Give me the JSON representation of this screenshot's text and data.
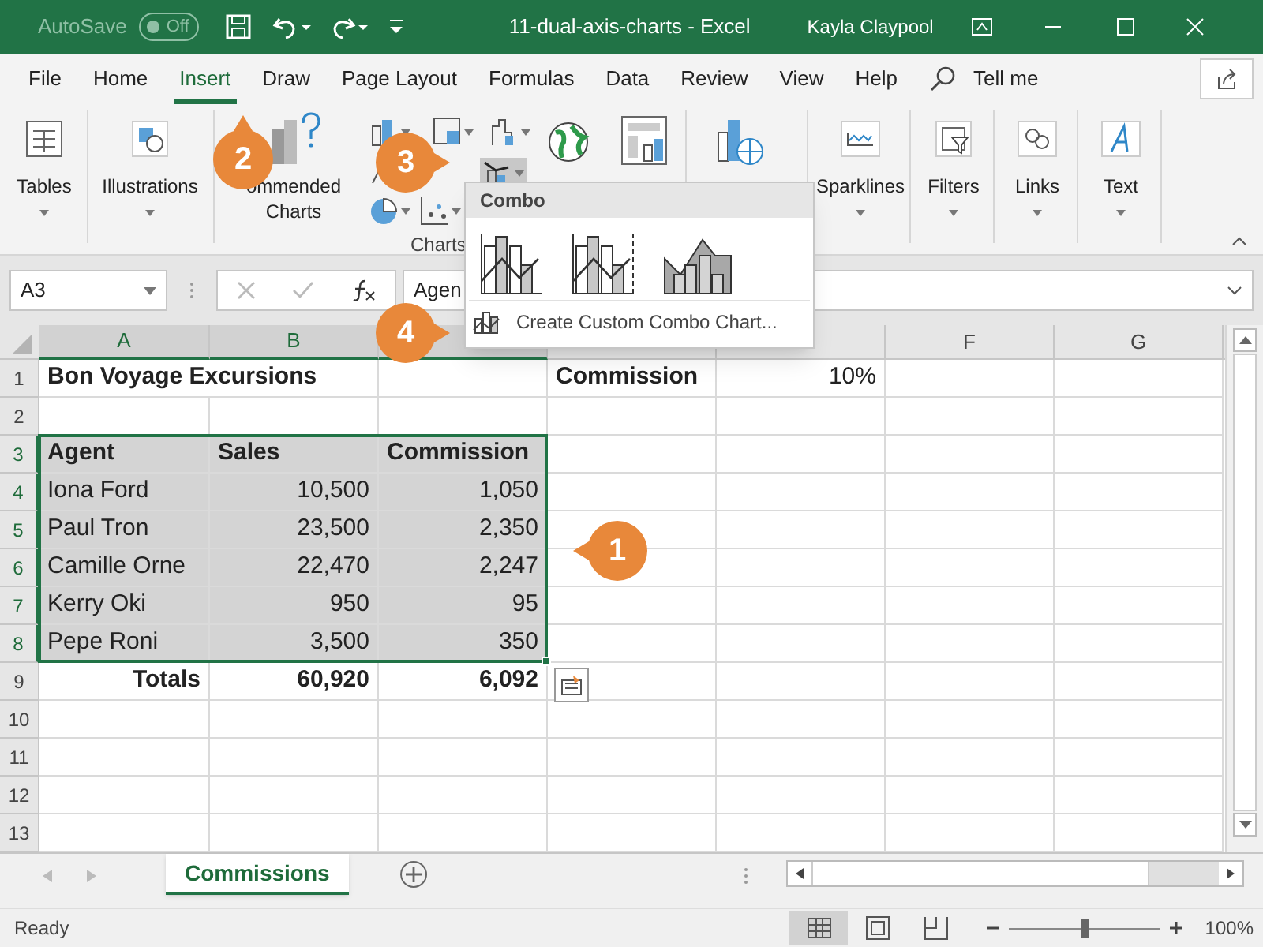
{
  "title_bar": {
    "autosave_label": "AutoSave",
    "autosave_toggle": {
      "label": "Off",
      "on": false
    },
    "title": "11-dual-axis-charts  -  Excel",
    "user": "Kayla Claypool"
  },
  "tabs": [
    {
      "label": "File",
      "selected": false
    },
    {
      "label": "Home",
      "selected": false
    },
    {
      "label": "Insert",
      "selected": true
    },
    {
      "label": "Draw",
      "selected": false
    },
    {
      "label": "Page Layout",
      "selected": false
    },
    {
      "label": "Formulas",
      "selected": false
    },
    {
      "label": "Data",
      "selected": false
    },
    {
      "label": "Review",
      "selected": false
    },
    {
      "label": "View",
      "selected": false
    },
    {
      "label": "Help",
      "selected": false
    }
  ],
  "tell_me": "Tell me",
  "ribbon": {
    "items": [
      {
        "kind": "tables",
        "label": "Tables"
      },
      {
        "kind": "illustrations",
        "label": "Illustrations"
      },
      {
        "kind": "recommended",
        "label": "ommended Charts"
      },
      {
        "kind": "chart-grid"
      },
      {
        "kind": "maps"
      },
      {
        "kind": "pivotchart"
      },
      {
        "kind": "geo"
      },
      {
        "kind": "sparklines",
        "label": "Sparklines"
      },
      {
        "kind": "filters",
        "label": "Filters"
      },
      {
        "kind": "links",
        "label": "Links"
      },
      {
        "kind": "text",
        "label": "Text"
      }
    ],
    "group_label": "Charts"
  },
  "combo_menu": {
    "header": "Combo",
    "options": [
      {
        "kind": "clustered"
      },
      {
        "kind": "secondary"
      },
      {
        "kind": "area"
      }
    ],
    "custom": "Create Custom Combo Chart..."
  },
  "formula_bar": {
    "name_box": "A3",
    "formula": "Agen"
  },
  "columns": [
    {
      "label": "A",
      "selected": true
    },
    {
      "label": "B",
      "selected": true
    },
    {
      "selected": true
    },
    {
      "selected": false
    },
    {
      "selected": false
    },
    {
      "label": "F",
      "selected": false
    },
    {
      "label": "G",
      "selected": false
    }
  ],
  "rows": [
    {
      "number": "1",
      "selected": false,
      "cells": [
        {
          "text": "Bon Voyage Excursions",
          "kind": "text",
          "bold": true,
          "selected": false
        },
        null,
        null,
        {
          "text": "Commission",
          "kind": "text",
          "bold": true,
          "selected": false
        },
        {
          "text": "10%",
          "kind": "number",
          "bold": false,
          "selected": false
        },
        null,
        null
      ]
    },
    {
      "number": "2",
      "selected": false,
      "cells": [
        null,
        null,
        null,
        null,
        null,
        null,
        null
      ]
    },
    {
      "number": "3",
      "selected": true,
      "cells": [
        {
          "text": "Agent",
          "kind": "text",
          "bold": true,
          "selected": true
        },
        {
          "text": "Sales",
          "kind": "text",
          "bold": true,
          "selected": true
        },
        {
          "text": "Commission",
          "kind": "text",
          "bold": true,
          "selected": true
        },
        null,
        null,
        null,
        null
      ]
    },
    {
      "number": "4",
      "selected": true,
      "cells": [
        {
          "text": "Iona Ford",
          "kind": "text",
          "bold": false,
          "selected": true
        },
        {
          "text": "10,500",
          "kind": "number",
          "bold": false,
          "selected": true
        },
        {
          "text": "1,050",
          "kind": "number",
          "bold": false,
          "selected": true
        },
        null,
        null,
        null,
        null
      ]
    },
    {
      "number": "5",
      "selected": true,
      "cells": [
        {
          "text": "Paul Tron",
          "kind": "text",
          "bold": false,
          "selected": true
        },
        {
          "text": "23,500",
          "kind": "number",
          "bold": false,
          "selected": true
        },
        {
          "text": "2,350",
          "kind": "number",
          "bold": false,
          "selected": true
        },
        null,
        null,
        null,
        null
      ]
    },
    {
      "number": "6",
      "selected": true,
      "cells": [
        {
          "text": "Camille  Orne",
          "kind": "text",
          "bold": false,
          "selected": true
        },
        {
          "text": "22,470",
          "kind": "number",
          "bold": false,
          "selected": true
        },
        {
          "text": "2,247",
          "kind": "number",
          "bold": false,
          "selected": true
        },
        null,
        null,
        null,
        null
      ]
    },
    {
      "number": "7",
      "selected": true,
      "cells": [
        {
          "text": "Kerry Oki",
          "kind": "text",
          "bold": false,
          "selected": true
        },
        {
          "text": "950",
          "kind": "number",
          "bold": false,
          "selected": true
        },
        {
          "text": "95",
          "kind": "number",
          "bold": false,
          "selected": true
        },
        null,
        null,
        null,
        null
      ]
    },
    {
      "number": "8",
      "selected": true,
      "cells": [
        {
          "text": "Pepe Roni",
          "kind": "text",
          "bold": false,
          "selected": true
        },
        {
          "text": "3,500",
          "kind": "number",
          "bold": false,
          "selected": true
        },
        {
          "text": "350",
          "kind": "number",
          "bold": false,
          "selected": true
        },
        null,
        null,
        null,
        null
      ]
    },
    {
      "number": "9",
      "selected": false,
      "cells": [
        {
          "text": "Totals",
          "kind": "number",
          "bold": true,
          "selected": false
        },
        {
          "text": "60,920",
          "kind": "number",
          "bold": true,
          "selected": false
        },
        {
          "text": "6,092",
          "kind": "number",
          "bold": true,
          "selected": false
        },
        null,
        null,
        null,
        null
      ]
    },
    {
      "number": "10",
      "selected": false,
      "cells": [
        null,
        null,
        null,
        null,
        null,
        null,
        null
      ]
    },
    {
      "number": "11",
      "selected": false,
      "cells": [
        null,
        null,
        null,
        null,
        null,
        null,
        null
      ]
    },
    {
      "number": "12",
      "selected": false,
      "cells": [
        null,
        null,
        null,
        null,
        null,
        null,
        null
      ]
    },
    {
      "number": "13",
      "selected": false,
      "cells": [
        null,
        null,
        null,
        null,
        null,
        null,
        null
      ]
    }
  ],
  "callouts": [
    "1",
    "2",
    "3",
    "4"
  ],
  "sheet_tabs": [
    {
      "label": "Commissions",
      "selected": true
    }
  ],
  "status_bar": {
    "text": "Ready",
    "views": [
      {
        "kind": "normal",
        "selected": true
      },
      {
        "kind": "page-layout",
        "selected": false
      },
      {
        "kind": "page-break",
        "selected": false
      }
    ],
    "zoom": {
      "level": 0.5,
      "reading": "100%"
    }
  }
}
